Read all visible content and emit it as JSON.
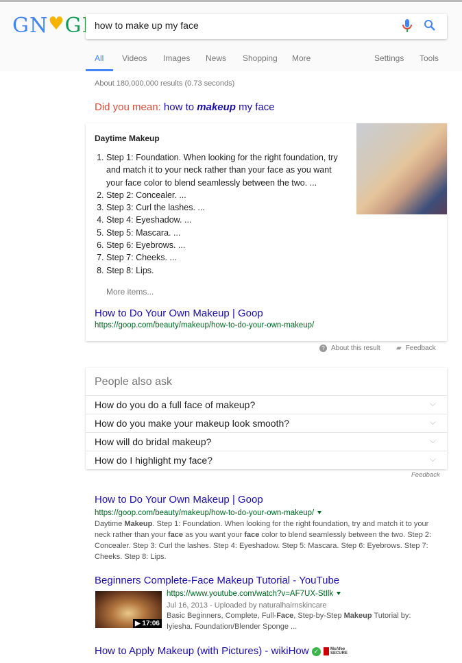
{
  "header": {
    "logo": "GOOGLE",
    "query": "how to make up my face",
    "tabs": [
      "All",
      "Videos",
      "Images",
      "News",
      "Shopping",
      "More"
    ],
    "settings": "Settings",
    "tools": "Tools",
    "active_tab": "All",
    "accent": "#4285f4"
  },
  "stats": "About 180,000,000 results (0.73 seconds)",
  "did_you_mean": {
    "label": "Did you mean:",
    "pre": "how to ",
    "bold": "makeup",
    "post": " my face"
  },
  "snippet": {
    "title": "Daytime Makeup",
    "steps": [
      "Step 1: Foundation. When looking for the right foundation, try and match it to your neck rather than your face as you want your face color to blend seamlessly between the two. ...",
      "Step 2: Concealer. ...",
      "Step 3: Curl the lashes. ...",
      "Step 4: Eyeshadow. ...",
      "Step 5: Mascara. ...",
      "Step 6: Eyebrows. ...",
      "Step 7: Cheeks. ...",
      "Step 8: Lips."
    ],
    "more": "More items...",
    "link": "How to Do Your Own Makeup | Goop",
    "url": "https://goop.com/beauty/makeup/how-to-do-your-own-makeup/",
    "about": "About this result",
    "feedback": "Feedback"
  },
  "paa": {
    "title": "People also ask",
    "questions": [
      "How do you do a full face of makeup?",
      "How do you make your makeup look smooth?",
      "How will do bridal makeup?",
      "How do I highlight my face?"
    ],
    "feedback": "Feedback"
  },
  "results": [
    {
      "title": "How to Do Your Own Makeup | Goop",
      "url": "https://goop.com/beauty/makeup/how-to-do-your-own-makeup/",
      "snippet": [
        "Daytime ",
        {
          "b": "Makeup"
        },
        ". Step 1: Foundation. When looking for the right foundation, try and match it to your neck rather than your ",
        {
          "b": "face"
        },
        " as you want your ",
        {
          "b": "face"
        },
        " color to blend seamlessly between the two. Step 2: Concealer. Step 3: Curl the lashes. Step 4: Eyeshadow. Step 5: Mascara. Step 6: Eyebrows. Step 7: Cheeks. Step 8: Lips."
      ]
    },
    {
      "title": "Beginners Complete-Face Makeup Tutorial - YouTube",
      "url": "https://www.youtube.com/watch?v=AF7UX-StIlk",
      "date": "Jul 16, 2013 - Uploaded by naturalhairnskincare",
      "duration": "▶ 17:06",
      "snippet": [
        "Basic Beginners, Complete, Full-",
        {
          "b": "Face"
        },
        ", Step-by-Step ",
        {
          "b": "Makeup"
        },
        " Tutorial by: Iyiesha. Foundation/Blender Sponge ..."
      ]
    },
    {
      "title": "How to Apply Makeup (with Pictures) - wikiHow",
      "badge": "McAfee SECURE"
    }
  ]
}
